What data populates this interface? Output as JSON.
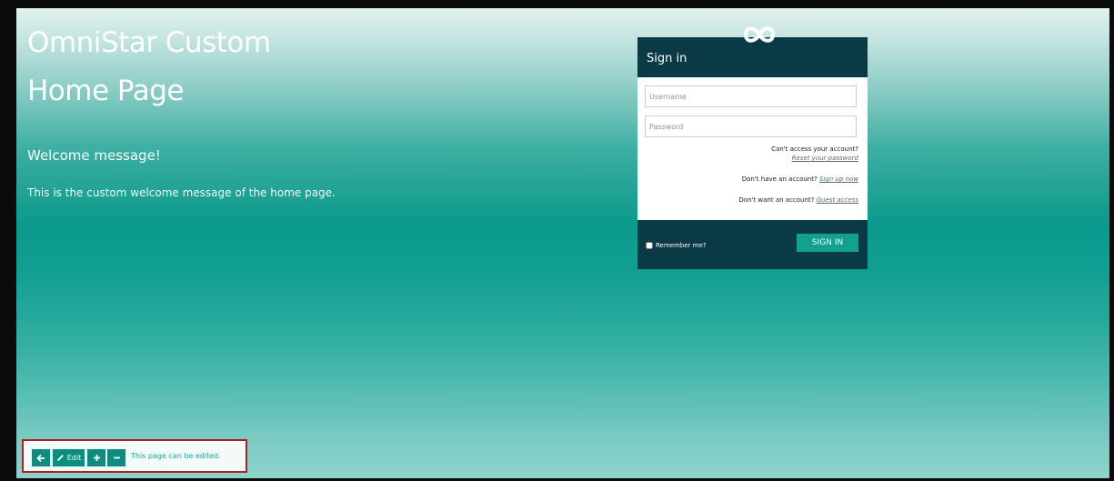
{
  "page": {
    "title_line1": "OmniStar Custom",
    "title_line2": "Home Page",
    "welcome_heading": "Welcome message!",
    "welcome_text": "This is the custom welcome message of the home page."
  },
  "signin": {
    "title": "Sign in",
    "logo_icon": "infinity-icon",
    "username_placeholder": "Username",
    "password_placeholder": "Password",
    "cant_access": "Can't access your account?",
    "reset_link": "Reset your password",
    "no_account": "Don't have an account?",
    "signup_link": "Sign up now",
    "no_want_account": "Don't want an account?",
    "guest_link": "Guest access",
    "remember_label": "Remember me?",
    "button_label": "SIGN IN"
  },
  "toolbar": {
    "back_icon": "arrow-left-icon",
    "edit_label": "Edit",
    "edit_icon": "pencil-icon",
    "add_icon": "plus-icon",
    "remove_icon": "minus-icon",
    "status_text": "This page can be edited."
  },
  "colors": {
    "panel_dark": "#0a3a45",
    "accent": "#14a090",
    "highlight_border": "#b11e1e"
  }
}
